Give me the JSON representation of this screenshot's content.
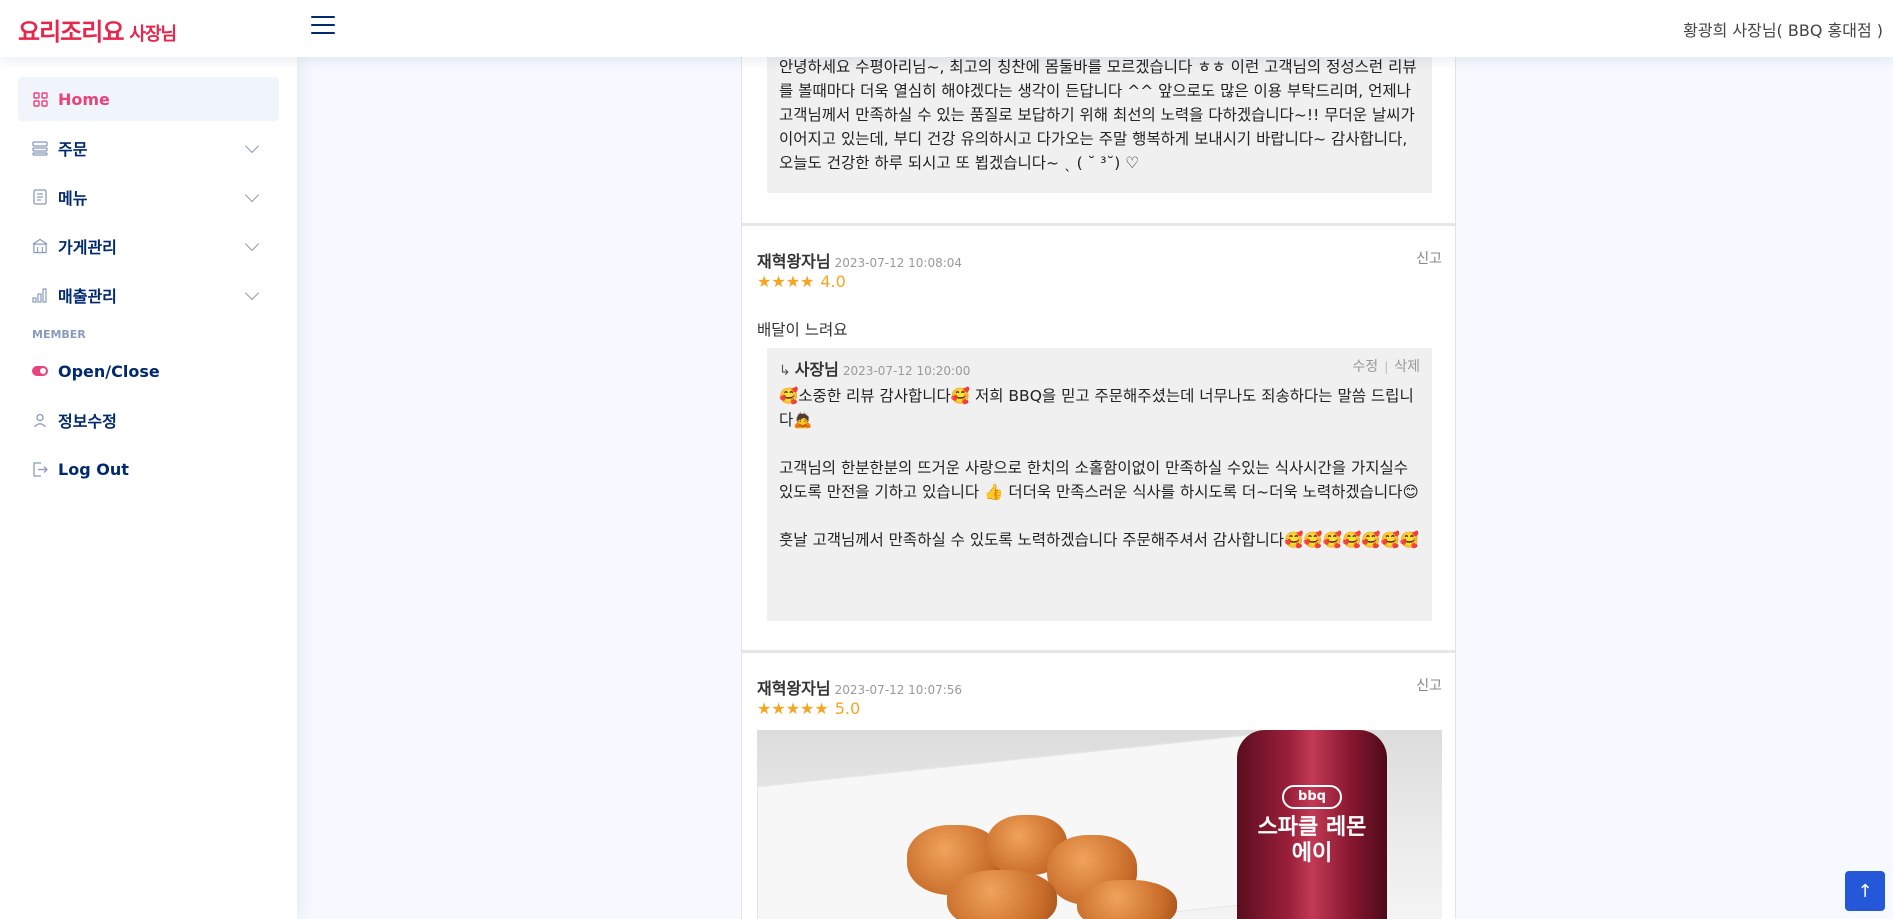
{
  "header": {
    "logo": "요리조리요",
    "logo_sub": "사장님",
    "owner": "황광희 사장님( BBQ 홍대점 )"
  },
  "sidebar": {
    "items": [
      {
        "label": "Home",
        "icon": "grid-icon"
      },
      {
        "label": "주문",
        "icon": "orders-icon"
      },
      {
        "label": "메뉴",
        "icon": "menu-icon"
      },
      {
        "label": "가게관리",
        "icon": "store-icon"
      },
      {
        "label": "매출관리",
        "icon": "bar-chart-icon"
      }
    ],
    "heading": "MEMBER",
    "member_items": [
      {
        "label": "Open/Close",
        "icon": "toggle-icon"
      },
      {
        "label": "정보수정",
        "icon": "person-icon"
      },
      {
        "label": "Log Out",
        "icon": "logout-icon"
      }
    ]
  },
  "top_reply": {
    "text": "안녕하세요 수평아리님~, 최고의 칭찬에 몸둘바를 모르겠습니다 ㅎㅎ 이런 고객님의 정성스런 리뷰를 볼때마다 더욱 열심히 해야겠다는 생각이 든답니다 ^^ 앞으로도 많은 이용 부탁드리며, 언제나 고객님께서 만족하실 수 있는 품질로 보답하기 위해 최선의 노력을 다하겠습니다~!! 무더운 날씨가 이어지고 있는데, 부디 건강 유의하시고 다가오는 주말 행복하게 보내시기 바랍니다~ 감사합니다, 오늘도 건강한 하루 되시고 또 뵙겠습니다~ ˎ ( ˘ ³˘) ♡"
  },
  "reviews": [
    {
      "name": "재혁왕자님",
      "date": "2023-07-12 10:08:04",
      "report": "신고",
      "stars": "★★★★",
      "score": "4.0",
      "body": "배달이 느려요",
      "reply": {
        "arrow": "↳",
        "name": "사장님",
        "date": "2023-07-12 10:20:00",
        "edit": "수정",
        "sep": "|",
        "delete": "삭제",
        "body": "🥰소중한 리뷰 감사합니다🥰 저희 BBQ을 믿고 주문해주셨는데 너무나도 죄송하다는 말씀 드립니다🙇\n\n고객님의 한분한분의 뜨거운 사랑으로 한치의 소홀함이없이 만족하실 수있는 식사시간을 가지실수있도록 만전을 기하고 있습니다 👍 더더욱 만족스러운 식사를 하시도록 더~더욱 노력하겠습니다😊\n\n훗날 고객님께서 만족하실 수 있도록 노력하겠습니다 주문해주셔서 감사합니다🥰🥰🥰🥰🥰🥰🥰"
      }
    },
    {
      "name": "재혁왕자님",
      "date": "2023-07-12 10:07:56",
      "report": "신고",
      "stars": "★★★★★",
      "score": "5.0"
    }
  ],
  "photo": {
    "bottle_brand": "bbq",
    "bottle_text": "스파클 레몬에이"
  },
  "scroll_top": "↑",
  "colors": {
    "brand": "#e8254a",
    "active": "#e8437a",
    "nav_text": "#012970",
    "star": "#f5a623",
    "scroll_btn": "#2558d8"
  }
}
